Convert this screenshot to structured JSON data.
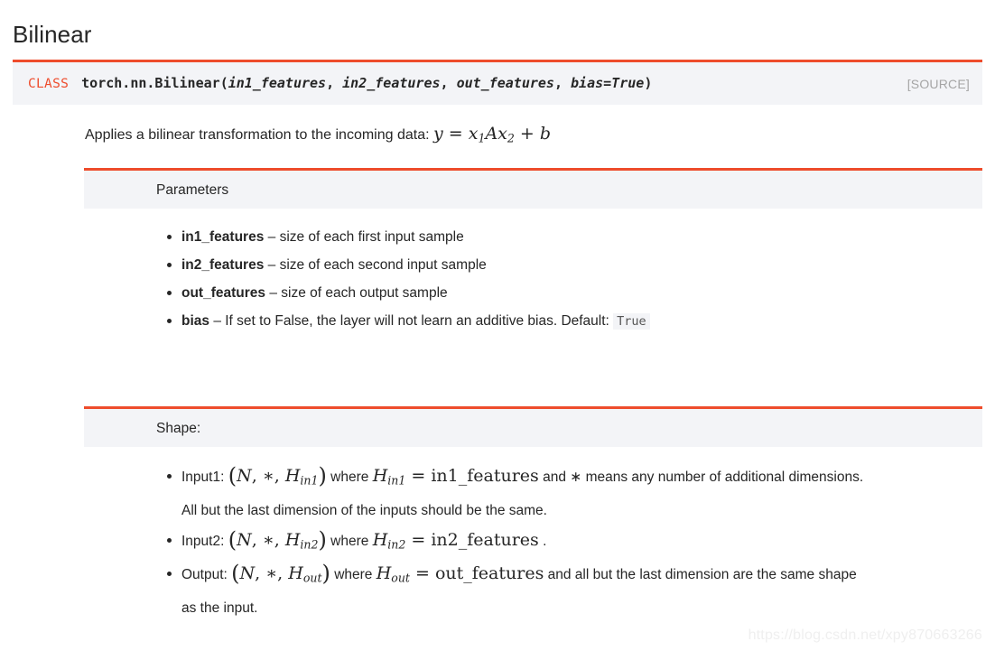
{
  "page": {
    "title": "Bilinear"
  },
  "signature": {
    "class_label": "CLASS",
    "qualified_name": "torch.nn.Bilinear",
    "open_paren": "(",
    "close_paren": ")",
    "args": [
      {
        "text": "in1_features",
        "sep": ", "
      },
      {
        "text": "in2_features",
        "sep": ", "
      },
      {
        "text": "out_features",
        "sep": ", "
      },
      {
        "text": "bias=True",
        "sep": ""
      }
    ],
    "source_label": "[SOURCE]"
  },
  "description": {
    "text": "Applies a bilinear transformation to the incoming data:",
    "formula": {
      "y": "y",
      "equals": "=",
      "x1": "x",
      "x1_sub": "1",
      "A": "A",
      "x2": "x",
      "x2_sub": "2",
      "plus": "+",
      "b": "b"
    }
  },
  "parameters_section": {
    "heading": "Parameters",
    "items": [
      {
        "name": "in1_features",
        "dash": " – ",
        "desc": "size of each first input sample"
      },
      {
        "name": "in2_features",
        "dash": " – ",
        "desc": "size of each second input sample"
      },
      {
        "name": "out_features",
        "dash": " – ",
        "desc": "size of each output sample"
      },
      {
        "name": "bias",
        "dash": " – ",
        "desc": "If set to False, the layer will not learn an additive bias. Default:",
        "code_value": "True"
      }
    ]
  },
  "shape_section": {
    "heading": "Shape:",
    "items": [
      {
        "label": "Input1:",
        "tuple": {
          "N": "N",
          "star": "∗",
          "H": "H",
          "H_sub": "in1"
        },
        "where": "where",
        "lhs": {
          "H": "H",
          "H_sub": "in1"
        },
        "equals": "=",
        "rhs": "in1_features",
        "tail": "and ∗ means any number of additional dimensions.",
        "continuation": "All but the last dimension of the inputs should be the same."
      },
      {
        "label": "Input2:",
        "tuple": {
          "N": "N",
          "star": "∗",
          "H": "H",
          "H_sub": "in2"
        },
        "where": "where",
        "lhs": {
          "H": "H",
          "H_sub": "in2"
        },
        "equals": "=",
        "rhs": "in2_features",
        "tail": ".",
        "continuation": ""
      },
      {
        "label": "Output:",
        "tuple": {
          "N": "N",
          "star": "∗",
          "H": "H",
          "H_sub": "out"
        },
        "where": "where",
        "lhs": {
          "H": "H",
          "H_sub": "out"
        },
        "equals": "=",
        "rhs": "out_features",
        "tail": "and all but the last dimension are the same shape",
        "continuation": "as the input."
      }
    ]
  },
  "watermark": {
    "text": "https://blog.csdn.net/xpy870663266"
  },
  "colors": {
    "accent": "#ee4c2c",
    "panel_bg": "#f3f4f7",
    "text": "#262626",
    "muted": "#a5a5a5"
  }
}
